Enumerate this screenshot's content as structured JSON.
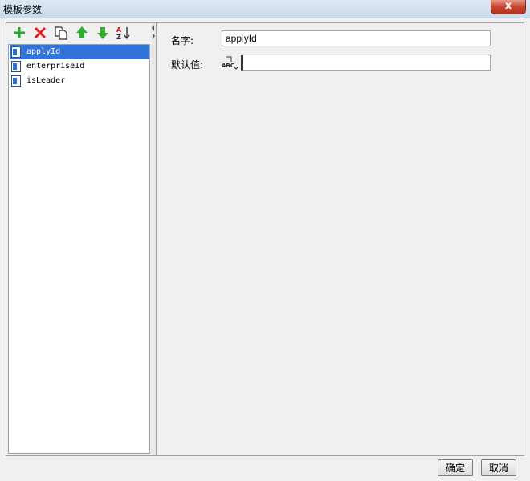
{
  "window": {
    "title": "模板参数",
    "close_glyph": "x"
  },
  "toolbar": {
    "buttons": [
      {
        "icon": "add-icon",
        "color": "#22a82a"
      },
      {
        "icon": "delete-icon",
        "color": "#e02020"
      },
      {
        "icon": "copy-icon",
        "color": "#2a2a2a"
      },
      {
        "icon": "move-up-icon",
        "color": "#2fae2f"
      },
      {
        "icon": "move-down-icon",
        "color": "#2fae2f"
      },
      {
        "icon": "sort-icon",
        "color": "#d02020"
      }
    ]
  },
  "tree": {
    "items": [
      {
        "label": "applyId",
        "selected": true
      },
      {
        "label": "enterpriseId",
        "selected": false
      },
      {
        "label": "isLeader",
        "selected": false
      }
    ],
    "selection_color": "#3173d6"
  },
  "form": {
    "name_label": "名字:",
    "name_value": "applyId",
    "default_label": "默认值:",
    "default_value": "",
    "default_type_icon": "abc-text-type-icon",
    "default_type_text": "ABC"
  },
  "footer": {
    "ok_label": "确定",
    "cancel_label": "取消"
  }
}
